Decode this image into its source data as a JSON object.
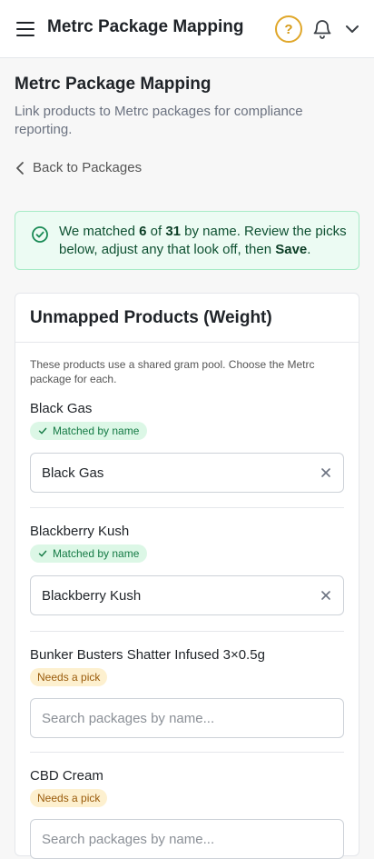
{
  "header": {
    "app_title": "Metrc Package Mapping",
    "help_glyph": "?",
    "icons": [
      "menu-icon",
      "help-icon",
      "bell-icon",
      "chevron-down-icon"
    ]
  },
  "page": {
    "title": "Metrc Package Mapping",
    "subtitle": "Link products to Metrc packages for compliance reporting.",
    "back_label": "Back to Packages"
  },
  "alert": {
    "text_1": "We matched ",
    "matched_count": "6",
    "text_2": " of ",
    "total_count": "31",
    "text_3": " by name. Review the picks below, adjust any that look off, then ",
    "save_word": "Save",
    "text_4": ".",
    "color": "#ecfbf3"
  },
  "card": {
    "title": "Unmapped Products (Weight)",
    "description": "These products use a shared gram pool. Choose the Metrc package for each.",
    "items": [
      {
        "name": "Black Gas",
        "status": "Matched by name",
        "value": "Black Gas",
        "placeholder": ""
      },
      {
        "name": "Blackberry Kush",
        "status": "Matched by name",
        "value": "Blackberry Kush",
        "placeholder": ""
      },
      {
        "name": "Bunker Busters Shatter Infused 3×0.5g",
        "status": "Needs a pick",
        "value": "",
        "placeholder": "Search packages by name..."
      },
      {
        "name": "CBD Cream",
        "status": "Needs a pick",
        "value": "",
        "placeholder": "Search packages by name..."
      }
    ]
  },
  "colors": {
    "accent_help": "#e0a72a",
    "matched_badge": "#dcf7e6",
    "needs_badge": "#fdf0cf"
  }
}
